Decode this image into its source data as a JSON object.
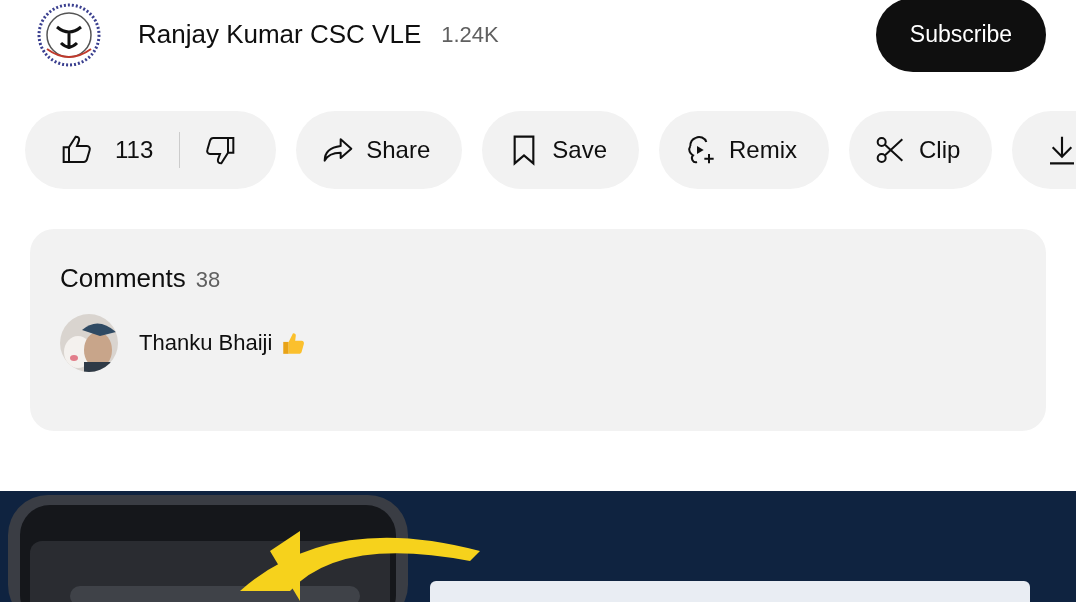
{
  "channel": {
    "name": "Ranjay Kumar CSC VLE",
    "subscribers": "1.24K",
    "subscribe_label": "Subscribe"
  },
  "actions": [
    {
      "kind": "like",
      "count": "113"
    },
    {
      "kind": "share",
      "label": "Share"
    },
    {
      "kind": "save",
      "label": "Save"
    },
    {
      "kind": "remix",
      "label": "Remix"
    },
    {
      "kind": "clip",
      "label": "Clip"
    },
    {
      "kind": "download"
    }
  ],
  "comments": {
    "title": "Comments",
    "count": "38",
    "top_comment": {
      "text": "Thanku Bhaiji"
    }
  }
}
